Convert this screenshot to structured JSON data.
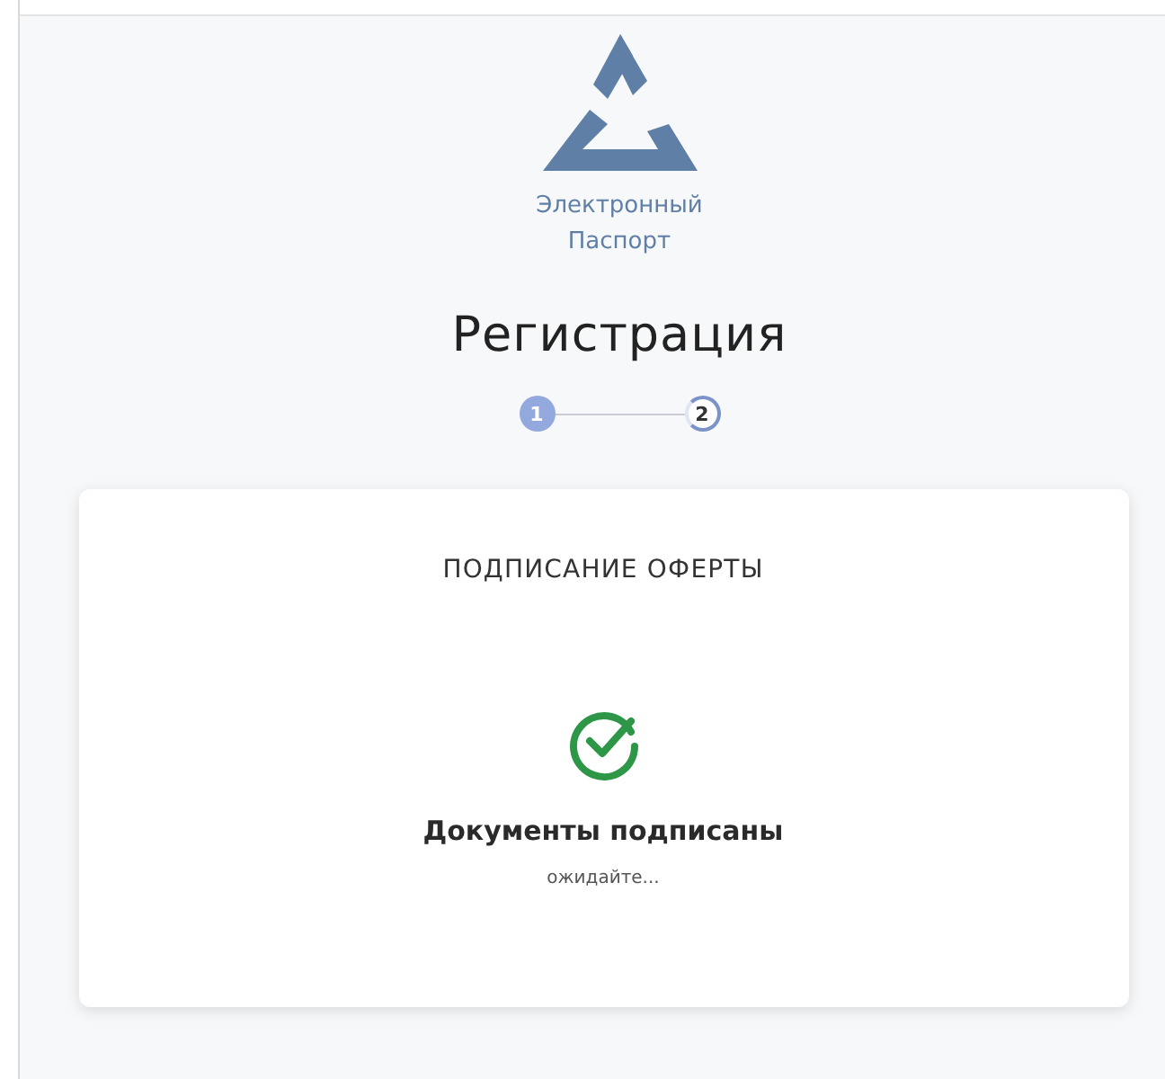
{
  "logo": {
    "line_1": "Электронный",
    "line_2": "Паспорт"
  },
  "title": "Регистрация",
  "steps": [
    {
      "label": "1",
      "selected": true
    },
    {
      "label": "2",
      "selected": false
    }
  ],
  "card": {
    "heading": "ПОДПИСАНИЕ ОФЕРТЫ",
    "status": "Документы подписаны",
    "note": "ожидайте..."
  }
}
